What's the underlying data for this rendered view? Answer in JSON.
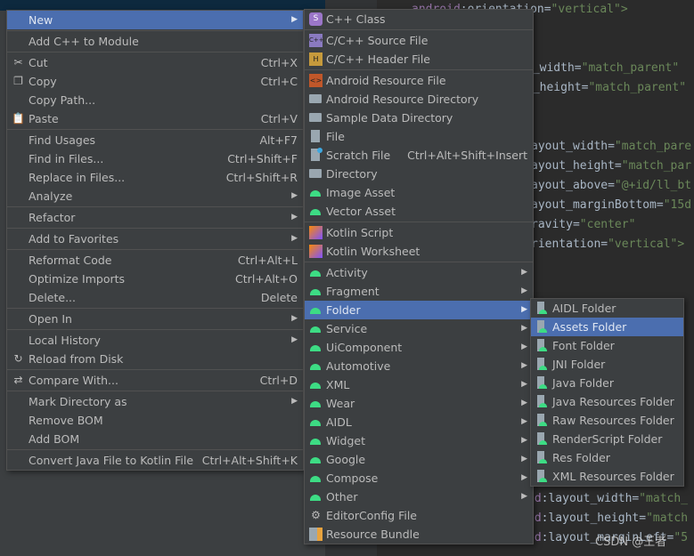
{
  "code_lines": [
    {
      "pre": "android",
      "attr": ":orientation=",
      "val": "\"vertical\">"
    },
    {
      "pre": "",
      "attr": "t_width=",
      "val": "\"match_parent\""
    },
    {
      "pre": "",
      "attr": "t_height=",
      "val": "\"match_parent\""
    },
    {
      "pre": "",
      "attr": "ayout_width=",
      "val": "\"match_pare"
    },
    {
      "pre": "",
      "attr": "ayout_height=",
      "val": "\"match_par"
    },
    {
      "pre": "",
      "attr": "ayout_above=",
      "val": "\"@+id/ll_bt"
    },
    {
      "pre": "",
      "attr": "ayout_marginBottom=",
      "val": "\"15d"
    },
    {
      "pre": "",
      "attr": "ravity=",
      "val": "\"center\""
    },
    {
      "pre": "",
      "attr": "rientation=",
      "val": "\"vertical\">"
    },
    {
      "pre": "id",
      "attr": ":layout_width=",
      "val": "\"match_"
    },
    {
      "pre": "id",
      "attr": ":layout_height=",
      "val": "\"match"
    },
    {
      "pre": "id",
      "attr": ":layout_marginLeft=",
      "val": "\"5"
    }
  ],
  "menu1": [
    {
      "label": "New",
      "arrow": true,
      "selected": true
    },
    "sep",
    {
      "label": "Add C++ to Module"
    },
    "sep",
    {
      "label": "Cut",
      "shortcut": "Ctrl+X",
      "icon": "scissors-icon"
    },
    {
      "label": "Copy",
      "shortcut": "Ctrl+C",
      "icon": "copy-icon"
    },
    {
      "label": "Copy Path..."
    },
    {
      "label": "Paste",
      "shortcut": "Ctrl+V",
      "icon": "clipboard-icon"
    },
    "sep",
    {
      "label": "Find Usages",
      "shortcut": "Alt+F7"
    },
    {
      "label": "Find in Files...",
      "shortcut": "Ctrl+Shift+F"
    },
    {
      "label": "Replace in Files...",
      "shortcut": "Ctrl+Shift+R"
    },
    {
      "label": "Analyze",
      "arrow": true
    },
    "sep",
    {
      "label": "Refactor",
      "arrow": true
    },
    "sep",
    {
      "label": "Add to Favorites",
      "arrow": true
    },
    "sep",
    {
      "label": "Reformat Code",
      "shortcut": "Ctrl+Alt+L"
    },
    {
      "label": "Optimize Imports",
      "shortcut": "Ctrl+Alt+O"
    },
    {
      "label": "Delete...",
      "shortcut": "Delete"
    },
    "sep",
    {
      "label": "Open In",
      "arrow": true
    },
    "sep",
    {
      "label": "Local History",
      "arrow": true
    },
    {
      "label": "Reload from Disk",
      "icon": "reload-icon"
    },
    "sep",
    {
      "label": "Compare With...",
      "shortcut": "Ctrl+D",
      "icon": "compare-icon"
    },
    "sep",
    {
      "label": "Mark Directory as",
      "arrow": true
    },
    {
      "label": "Remove BOM"
    },
    {
      "label": "Add BOM"
    },
    "sep",
    {
      "label": "Convert Java File to Kotlin File",
      "shortcut": "Ctrl+Alt+Shift+K"
    }
  ],
  "menu2": [
    {
      "label": "C++ Class",
      "icon": "cpp-class-icon"
    },
    "sep",
    {
      "label": "C/C++ Source File",
      "icon": "cpp-source-icon"
    },
    {
      "label": "C/C++ Header File",
      "icon": "cpp-header-icon"
    },
    "sep",
    {
      "label": "Android Resource File",
      "icon": "android-resource-file-icon"
    },
    {
      "label": "Android Resource Directory",
      "icon": "folder-icon"
    },
    {
      "label": "Sample Data Directory",
      "icon": "folder-icon"
    },
    {
      "label": "File",
      "icon": "file-icon"
    },
    {
      "label": "Scratch File",
      "shortcut": "Ctrl+Alt+Shift+Insert",
      "icon": "scratch-file-icon"
    },
    {
      "label": "Directory",
      "icon": "folder-icon"
    },
    {
      "label": "Image Asset",
      "icon": "android-icon"
    },
    {
      "label": "Vector Asset",
      "icon": "android-icon"
    },
    "sep",
    {
      "label": "Kotlin Script",
      "icon": "kotlin-icon"
    },
    {
      "label": "Kotlin Worksheet",
      "icon": "kotlin-icon"
    },
    "sep",
    {
      "label": "Activity",
      "icon": "android-icon",
      "arrow": true
    },
    {
      "label": "Fragment",
      "icon": "android-icon",
      "arrow": true
    },
    {
      "label": "Folder",
      "icon": "android-icon",
      "arrow": true,
      "selected": true
    },
    {
      "label": "Service",
      "icon": "android-icon",
      "arrow": true
    },
    {
      "label": "UiComponent",
      "icon": "android-icon",
      "arrow": true
    },
    {
      "label": "Automotive",
      "icon": "android-icon",
      "arrow": true
    },
    {
      "label": "XML",
      "icon": "android-icon",
      "arrow": true
    },
    {
      "label": "Wear",
      "icon": "android-icon",
      "arrow": true
    },
    {
      "label": "AIDL",
      "icon": "android-icon",
      "arrow": true
    },
    {
      "label": "Widget",
      "icon": "android-icon",
      "arrow": true
    },
    {
      "label": "Google",
      "icon": "android-icon",
      "arrow": true
    },
    {
      "label": "Compose",
      "icon": "android-icon",
      "arrow": true
    },
    {
      "label": "Other",
      "icon": "android-icon",
      "arrow": true
    },
    {
      "label": "EditorConfig File",
      "icon": "gear-icon"
    },
    {
      "label": "Resource Bundle",
      "icon": "resource-bundle-icon"
    }
  ],
  "menu3": [
    {
      "label": "AIDL Folder",
      "icon": "android-folder-icon"
    },
    {
      "label": "Assets Folder",
      "icon": "android-folder-icon",
      "selected": true
    },
    {
      "label": "Font Folder",
      "icon": "android-folder-icon"
    },
    {
      "label": "JNI Folder",
      "icon": "android-folder-icon"
    },
    {
      "label": "Java Folder",
      "icon": "android-folder-icon"
    },
    {
      "label": "Java Resources Folder",
      "icon": "android-folder-icon"
    },
    {
      "label": "Raw Resources Folder",
      "icon": "android-folder-icon"
    },
    {
      "label": "RenderScript Folder",
      "icon": "android-folder-icon"
    },
    {
      "label": "Res Folder",
      "icon": "android-folder-icon"
    },
    {
      "label": "XML Resources Folder",
      "icon": "android-folder-icon"
    }
  ],
  "watermark": "CSDN @王者",
  "colors": {
    "selection": "#4b6eaf",
    "menu_bg": "#3c3f41",
    "editor_bg": "#2b2b2b"
  }
}
